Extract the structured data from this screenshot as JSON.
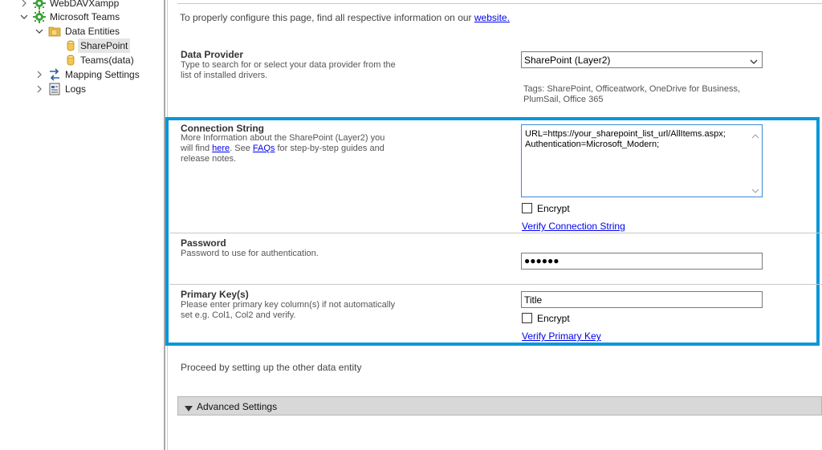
{
  "tree": {
    "items": [
      {
        "label": "WebDAVXampp"
      },
      {
        "label": "Microsoft Teams"
      },
      {
        "label": "Data Entities"
      },
      {
        "label": "SharePoint"
      },
      {
        "label": "Teams(data)"
      },
      {
        "label": "Mapping Settings"
      },
      {
        "label": "Logs"
      }
    ]
  },
  "intro": {
    "text": "To properly configure this page, find all respective information on our",
    "link": "website."
  },
  "data_provider": {
    "title": "Data Provider",
    "desc_line1": "Type to search for or select your data provider from the",
    "desc_line2": "list of installed drivers.",
    "selected": "SharePoint (Layer2)",
    "tags_line1": "Tags: SharePoint, Officeatwork, OneDrive for Business,",
    "tags_line2": "PlumSail, Office 365"
  },
  "connection_string": {
    "title": "Connection String",
    "desc_line1": "More Information about the SharePoint (Layer2) you",
    "desc_will_find": "will find",
    "desc_here": "here",
    "desc_see": ". See",
    "desc_faqs": "FAQs",
    "desc_rest": "for step-by-step guides and",
    "desc_line3": "release notes.",
    "value_line1": "URL=https://your_sharepoint_list_url/AllItems.aspx;",
    "value_line2": "Authentication=Microsoft_Modern;",
    "encrypt_label": "Encrypt",
    "encrypt_checked": false,
    "verify_link": "Verify Connection String"
  },
  "password": {
    "title": "Password",
    "desc": "Password to use for authentication.",
    "masked_value": "●●●●●●"
  },
  "primary_key": {
    "title": "Primary Key(s)",
    "desc_line1": "Please enter primary key column(s) if not automatically",
    "desc_line2": "set e.g. Col1, Col2 and verify.",
    "value": "Title",
    "encrypt_label": "Encrypt",
    "encrypt_checked": false,
    "verify_link": "Verify Primary Key"
  },
  "proceed_text": "Proceed by setting up the other data entity",
  "advanced": {
    "label": "Advanced Settings"
  },
  "colors": {
    "highlight": "#0a96d8",
    "link": "#0000ee",
    "selected_bg": "#e5e5e5"
  }
}
